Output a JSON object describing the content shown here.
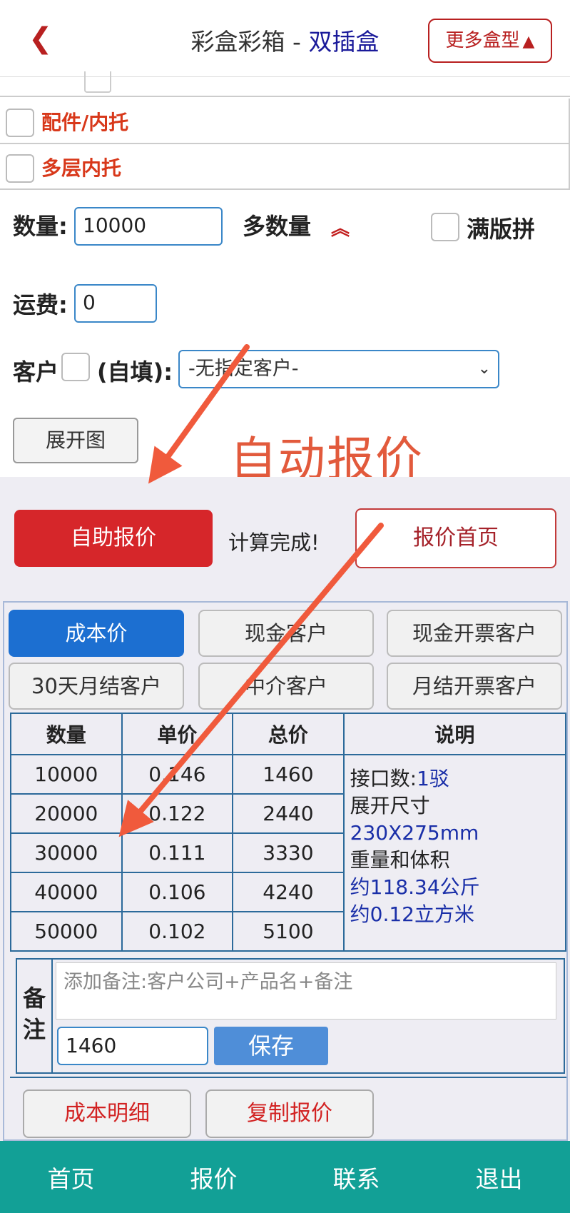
{
  "header": {
    "back_icon": "chevron-left-icon",
    "title_main": "彩盒彩箱 - ",
    "title_sub": "双插盒",
    "more_label": "更多盒型",
    "more_icon": "triangle-up-icon",
    "accent_color": "#b82020"
  },
  "options": {
    "items": [
      {
        "label": "配件/内托",
        "checked": false
      },
      {
        "label": "多层内托",
        "checked": false
      }
    ]
  },
  "form": {
    "quantity_label": "数量:",
    "quantity_value": "10000",
    "multi_qty_label": "多数量",
    "multi_qty_icon": "double-chevron-up-icon",
    "full_plate_label": "满版拼",
    "freight_label": "运费:",
    "freight_value": "0",
    "customer_label": "客户",
    "self_fill_label": "(自填):",
    "customer_select": "-无指定客户-",
    "expand_button": "展开图"
  },
  "annotation": {
    "text": "自动报价",
    "color": "#e25a3c"
  },
  "actions": {
    "self_quote": "自助报价",
    "status": "计算完成!",
    "quote_home": "报价首页"
  },
  "price_tabs": [
    {
      "label": "成本价",
      "active": true
    },
    {
      "label": "现金客户",
      "active": false
    },
    {
      "label": "现金开票客户",
      "active": false
    },
    {
      "label": "30天月结客户",
      "active": false
    },
    {
      "label": "中介客户",
      "active": false
    },
    {
      "label": "月结开票客户",
      "active": false
    }
  ],
  "price_table": {
    "headers": [
      "数量",
      "单价",
      "总价",
      "说明"
    ],
    "rows": [
      {
        "qty": "10000",
        "unit": "0.146",
        "total": "1460"
      },
      {
        "qty": "20000",
        "unit": "0.122",
        "total": "2440"
      },
      {
        "qty": "30000",
        "unit": "0.111",
        "total": "3330"
      },
      {
        "qty": "40000",
        "unit": "0.106",
        "total": "4240"
      },
      {
        "qty": "50000",
        "unit": "0.102",
        "total": "5100"
      }
    ],
    "desc": {
      "joints_label": "接口数:",
      "joints_value": "1驳",
      "unfold_label": "展开尺寸",
      "unfold_value": "230X275mm",
      "weight_label": "重量和体积",
      "weight_value": "约118.34公斤",
      "volume_value": "约0.12立方米"
    }
  },
  "remark": {
    "label": "备注",
    "placeholder": "添加备注:客户公司+产品名+备注",
    "amount_value": "1460",
    "save_label": "保存"
  },
  "bottom_buttons": {
    "cost_detail": "成本明细",
    "copy_quote": "复制报价"
  },
  "bottom_nav": {
    "items": [
      "首页",
      "报价",
      "联系",
      "退出"
    ],
    "color": "#12a096"
  }
}
